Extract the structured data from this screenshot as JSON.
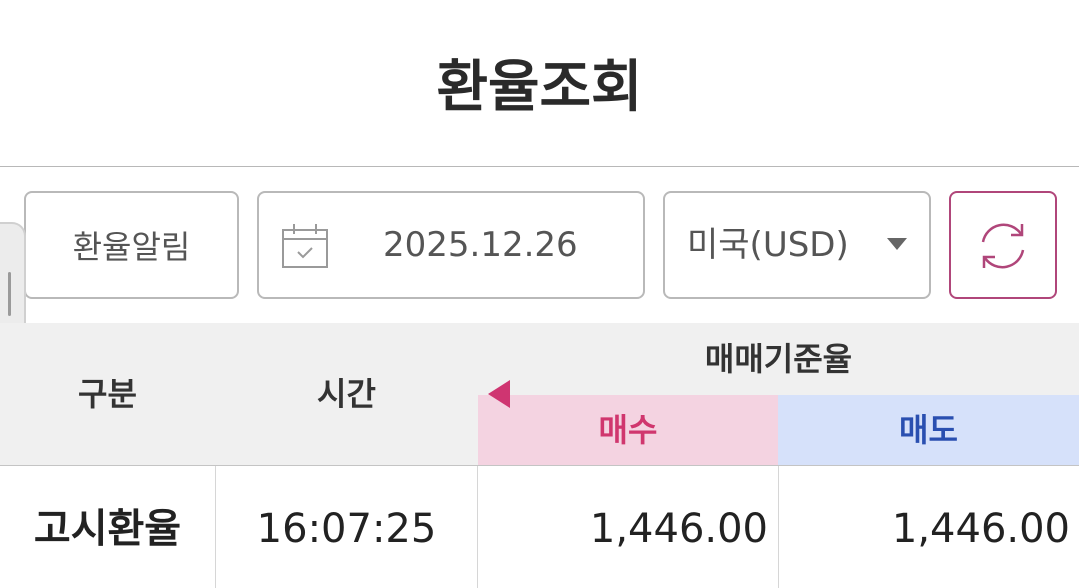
{
  "header": {
    "title": "환율조회"
  },
  "controls": {
    "alarm_label": "환율알림",
    "date_value": "2025.12.26",
    "currency_value": "미국(USD)",
    "calendar_icon": "calendar-icon",
    "refresh_icon": "refresh-icon",
    "accent_color": "#b0467a"
  },
  "table": {
    "headers": {
      "category": "구분",
      "time": "시간",
      "group": "매매기준율",
      "buy": "매수",
      "sell": "매도"
    },
    "rows": [
      {
        "label": "고시환율",
        "time": "16:07:25",
        "buy": "1,446.00",
        "sell": "1,446.00"
      }
    ],
    "colors": {
      "buy_bg": "#f4d3e1",
      "buy_text": "#d0366e",
      "sell_bg": "#d6e1fa",
      "sell_text": "#2a4fb0"
    }
  }
}
